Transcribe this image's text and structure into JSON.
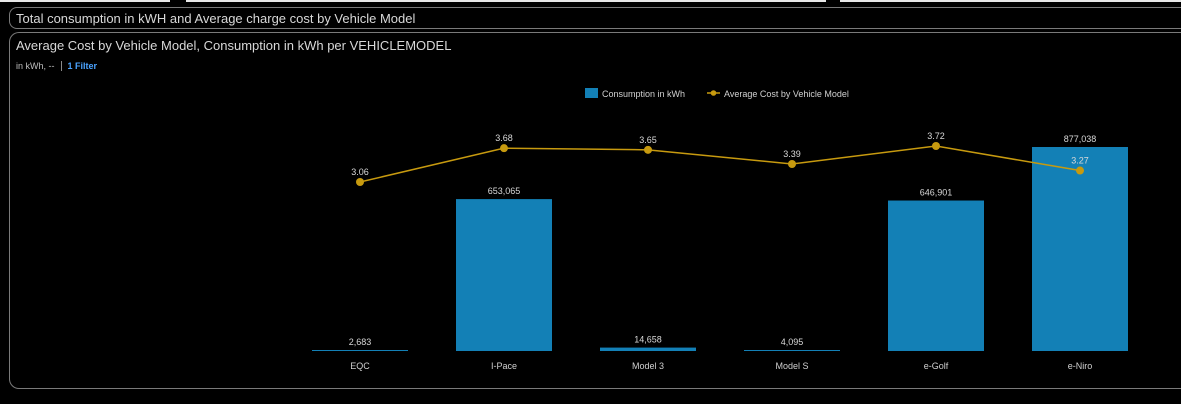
{
  "header": {
    "title": "Total consumption in kWH and Average charge cost by Vehicle Model"
  },
  "panel": {
    "title": "Average Cost by Vehicle Model, Consumption in kWh per VEHICLEMODEL",
    "unit_text": "in kWh, --",
    "filter_label": "1 Filter"
  },
  "colors": {
    "bar": "#1380b6",
    "line": "#c79a0f",
    "background": "#000000",
    "text": "#d0d0d0",
    "filter_link": "#4aa3ff"
  },
  "chart_data": {
    "type": "bar",
    "categories": [
      "EQC",
      "I-Pace",
      "Model 3",
      "Model S",
      "e-Golf",
      "e-Niro"
    ],
    "series": [
      {
        "name": "Consumption in kWh",
        "type": "bar",
        "axis": "left",
        "values": [
          2683,
          653065,
          14658,
          4095,
          646901,
          877038
        ],
        "labels": [
          "2,683",
          "653,065",
          "14,658",
          "4,095",
          "646,901",
          "877,038"
        ]
      },
      {
        "name": "Average Cost by Vehicle Model",
        "type": "line",
        "axis": "right",
        "values": [
          3.06,
          3.68,
          3.65,
          3.39,
          3.72,
          3.27
        ],
        "labels": [
          "3.06",
          "3.68",
          "3.65",
          "3.39",
          "3.72",
          "3.27"
        ]
      }
    ],
    "legend_position": "top-center",
    "grid": false
  }
}
